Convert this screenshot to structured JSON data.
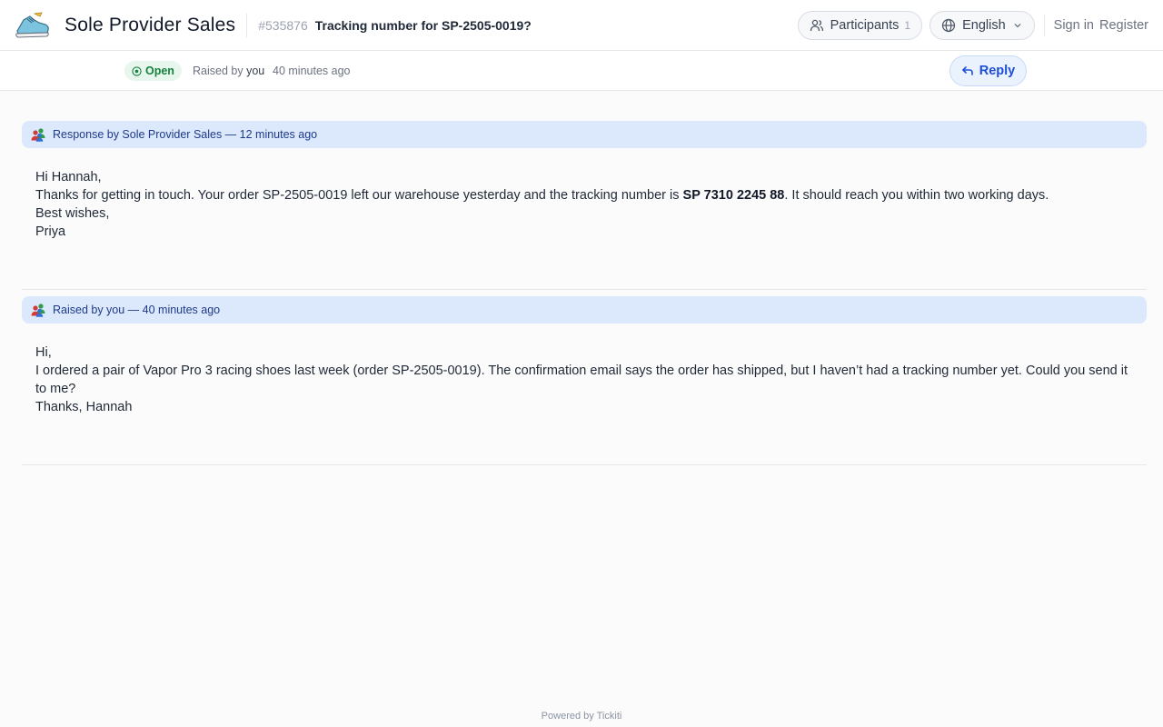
{
  "header": {
    "brand_name": "Sole Provider Sales",
    "ticket_id": "#535876",
    "ticket_title": "Tracking number for SP-2505-0019?",
    "participants_label": "Participants",
    "participants_count": "1",
    "language_label": "English",
    "sign_in_label": "Sign in",
    "register_label": "Register"
  },
  "status": {
    "badge": "Open",
    "raised_prefix": "Raised by",
    "raised_by": "you",
    "time": "40 minutes ago",
    "reply_label": "Reply"
  },
  "messages": [
    {
      "header": "Response by Sole Provider Sales — 12 minutes ago",
      "line1": "Hi Hannah,",
      "line2_before": "Thanks for getting in touch. Your order SP-2505-0019 left our warehouse yesterday and the tracking number is ",
      "line2_bold": "SP 7310 2245 88",
      "line2_after": ". It should reach you within two working days.",
      "line3": "Best wishes,",
      "line4": "Priya"
    },
    {
      "header": "Raised by you — 40 minutes ago",
      "line1": "Hi,",
      "line2": "I ordered a pair of Vapor Pro 3 racing shoes last week (order SP-2505-0019). The confirmation email says the order has shipped, but I haven’t had a tracking number yet. Could you send it to me?",
      "line3": "Thanks, Hannah"
    }
  ],
  "footer": {
    "prefix": "Powered by",
    "brand": "Tickiti"
  },
  "colors": {
    "accent": "#1d4ed8",
    "status_open": "#15803d",
    "message_header_bg": "#dce8fb"
  }
}
